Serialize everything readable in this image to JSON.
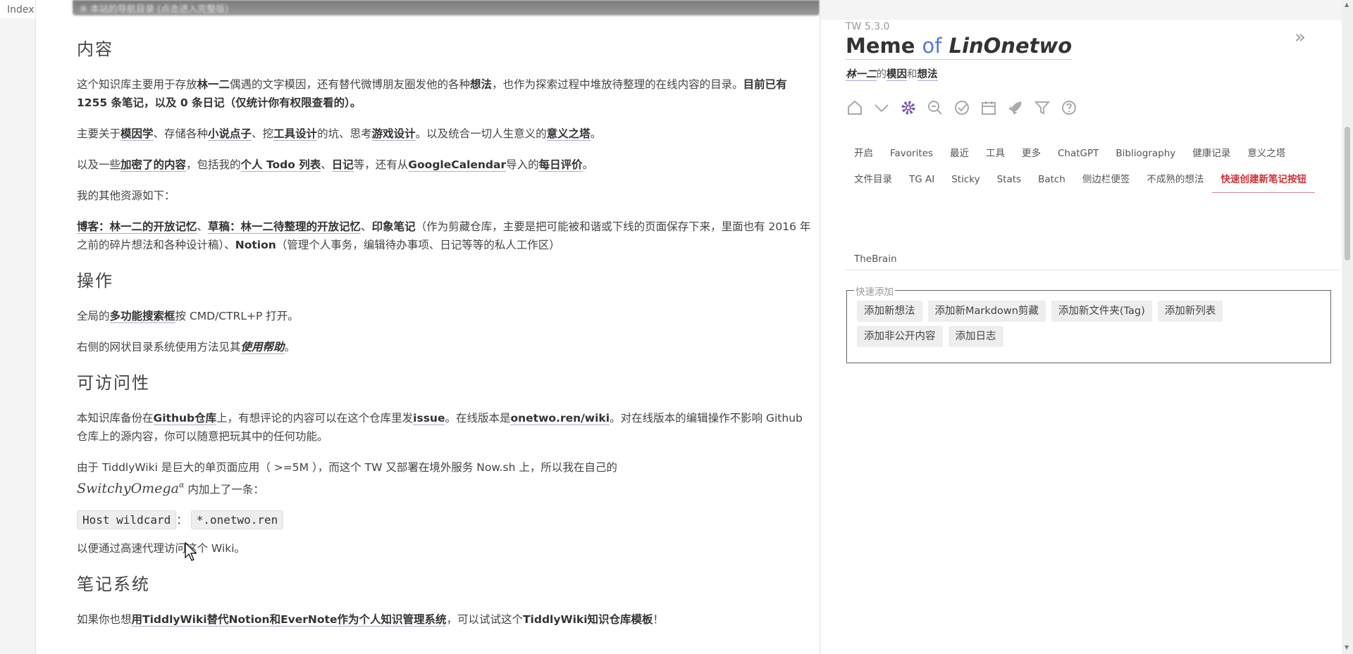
{
  "index_tab": "Index",
  "blurred_title": "※ 本站的导航目录 (点击进入完整版)",
  "story": {
    "sections": {
      "content": {
        "heading": "内容",
        "p1_a": "这个知识库主要用于存放",
        "p1_b": "林一二",
        "p1_c": "偶遇的文字模因，还有替代微博朋友圈发他的各种",
        "p1_d": "想法",
        "p1_e": "，也作为探索过程中堆放待整理的在线内容的目录。",
        "p1_f": "目前已有 1255 条笔记，以及 0 条日记（仅统计你有权限查看的）。",
        "p2_a": "主要关于",
        "p2_b": "模因学",
        "p2_c": "、存储各种",
        "p2_d": "小说点子",
        "p2_e": "、挖",
        "p2_f": "工具设计",
        "p2_g": "的坑、思考",
        "p2_h": "游戏设计",
        "p2_i": "。以及统合一切人生意义的",
        "p2_j": "意义之塔",
        "p2_k": "。",
        "p3_a": "以及一些",
        "p3_b": "加密了的内容",
        "p3_c": "，包括我的",
        "p3_d": "个人 Todo 列表",
        "p3_e": "、",
        "p3_f": "日记",
        "p3_g": "等，还有从",
        "p3_h": "GoogleCalendar",
        "p3_i": "导入的",
        "p3_j": "每日评价",
        "p3_k": "。",
        "p4": "我的其他资源如下：",
        "p5_a": "博客：林一二的开放记忆",
        "p5_b": "、",
        "p5_c": "草稿：林一二待整理的开放记忆",
        "p5_d": "、",
        "p5_e": "印象笔记",
        "p5_f": "（作为剪藏仓库，主要是把可能被和谐或下线的页面保存下来，里面也有 2016 年之前的碎片想法和各种设计稿）、",
        "p5_g": "Notion",
        "p5_h": "（管理个人事务，编辑待办事项、日记等等的私人工作区）"
      },
      "operation": {
        "heading": "操作",
        "p1_a": "全局的",
        "p1_b": "多功能搜索框",
        "p1_c": "按 CMD/CTRL+P 打开。",
        "p2_a": "右侧的网状目录系统使用方法见其",
        "p2_b": "使用帮助",
        "p2_c": "。"
      },
      "access": {
        "heading": "可访问性",
        "p1_a": "本知识库备份在",
        "p1_b": "Github仓库",
        "p1_c": "上，有想评论的内容可以在这个仓库里发",
        "p1_d": "issue",
        "p1_e": "。在线版本是",
        "p1_f": "onetwo.ren/wiki",
        "p1_g": "。对在线版本的编辑操作不影响 Github 仓库上的源内容，你可以随意把玩其中的任何功能。",
        "p2_a": "由于 TiddlyWiki 是巨大的单页面应用（ >=5M ），而这个 TW 又部署在境外服务 Now.sh 上，所以我在自己的",
        "p2_math": "SwitchyOmega",
        "p2_sup": "α",
        "p2_b": "内加上了一条：",
        "code1": "Host wildcard",
        "code_sep": "：",
        "code2": "*.onetwo.ren",
        "p3": "以便通过高速代理访问这个 Wiki。"
      },
      "notes": {
        "heading": "笔记系统",
        "p1_a": "如果你也想",
        "p1_b": "用TiddlyWiki替代Notion和EverNote作为个人知识管理系统",
        "p1_c": "，可以试试这个",
        "p1_d": "TiddlyWiki知识仓库模板",
        "p1_e": "！"
      }
    }
  },
  "sidebar": {
    "version": "TW 5.3.0",
    "title_a": "Meme",
    "title_of": "of",
    "title_name": "LinOnetwo",
    "subtitle_a": "林一二",
    "subtitle_b": "的",
    "subtitle_c": "模因",
    "subtitle_d": "和",
    "subtitle_e": "想法",
    "controls": [
      "home-icon",
      "chevron-down-icon",
      "gear-icon",
      "zoom-out-icon",
      "check-circle-icon",
      "calendar-icon",
      "rocket-icon",
      "filter-icon",
      "help-icon"
    ],
    "tabs": [
      "开启",
      "Favorites",
      "最近",
      "工具",
      "更多",
      "ChatGPT",
      "Bibliography",
      "健康记录",
      "意义之塔",
      "文件目录",
      "TG AI",
      "Sticky",
      "Stats",
      "Batch",
      "侧边栏便签",
      "不成熟的想法",
      "快速创建新笔记按钮"
    ],
    "brain_tab": "TheBrain",
    "quick_add": {
      "legend": "快速添加",
      "buttons": [
        "添加新想法",
        "添加新Markdown剪藏",
        "添加新文件夹(Tag)",
        "添加新列表",
        "添加非公开内容",
        "添加日志"
      ]
    }
  },
  "colors": {
    "accent_purple": "#7b56b8",
    "link_underline": "#b5a8d6",
    "active_tab_red": "#d0333a",
    "title_of_blue": "#5778d8"
  }
}
